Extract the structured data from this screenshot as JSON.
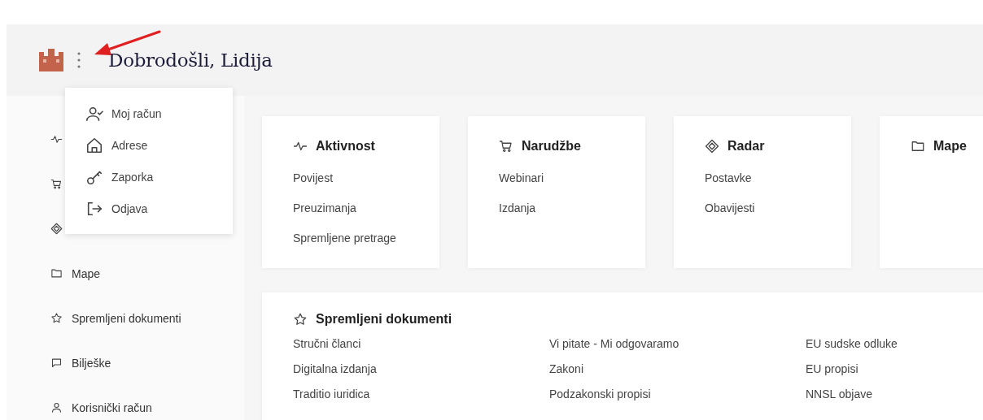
{
  "header": {
    "title": "Dobrodošli, Lidija"
  },
  "account_menu": {
    "items": [
      {
        "kind": "user-check",
        "label": "Moj račun"
      },
      {
        "kind": "home",
        "label": "Adrese"
      },
      {
        "kind": "key",
        "label": "Zaporka"
      },
      {
        "kind": "logout",
        "label": "Odjava"
      }
    ]
  },
  "sidebar": {
    "items": [
      {
        "kind": "activity"
      },
      {
        "kind": "cart"
      },
      {
        "kind": "radar"
      },
      {
        "kind": "folder",
        "label": "Mape"
      },
      {
        "kind": "star",
        "label": "Spremljeni dokumenti"
      },
      {
        "kind": "comment",
        "label": "Bilješke"
      },
      {
        "kind": "user",
        "label": "Korisnički račun"
      }
    ]
  },
  "cards": [
    {
      "kind": "activity",
      "title": "Aktivnost",
      "links": [
        "Povijest",
        "Preuzimanja",
        "Spremljene pretrage"
      ]
    },
    {
      "kind": "cart",
      "title": "Narudžbe",
      "links": [
        "Webinari",
        "Izdanja"
      ]
    },
    {
      "kind": "radar",
      "title": "Radar",
      "links": [
        "Postavke",
        "Obavijesti"
      ]
    },
    {
      "kind": "folder",
      "title": "Mape"
    }
  ],
  "saved_documents": {
    "kind": "star",
    "title": "Spremljeni dokumenti",
    "columns": [
      [
        "Stručni članci",
        "Digitalna izdanja",
        "Traditio iuridica"
      ],
      [
        "Vi pitate - Mi odgovaramo",
        "Zakoni",
        "Podzakonski propisi"
      ],
      [
        "EU sudske odluke",
        "EU propisi",
        "NNSL objave"
      ]
    ]
  }
}
